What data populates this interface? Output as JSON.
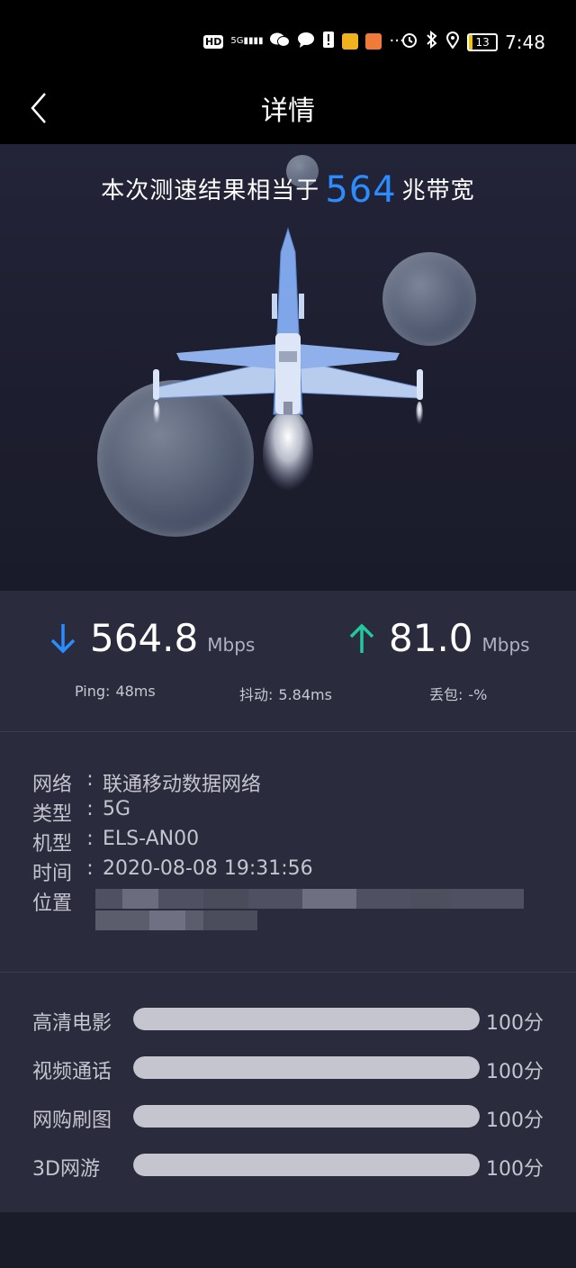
{
  "status_bar": {
    "time": "7:48",
    "battery": "13",
    "network": "5G",
    "hd_label": "HD"
  },
  "header": {
    "title": "详情"
  },
  "hero": {
    "prefix": "本次测速结果相当于",
    "bandwidth": "564",
    "suffix": "兆带宽"
  },
  "speed": {
    "download_value": "564.8",
    "download_unit": "Mbps",
    "upload_value": "81.0",
    "upload_unit": "Mbps",
    "ping_label": "Ping:",
    "ping_value": "48ms",
    "jitter_label": "抖动:",
    "jitter_value": "5.84ms",
    "loss_label": "丢包:",
    "loss_value": "-%"
  },
  "info": {
    "network_label": "网络",
    "network_value": "联通移动数据网络",
    "type_label": "类型",
    "type_value": "5G",
    "model_label": "机型",
    "model_value": "ELS-AN00",
    "time_label": "时间",
    "time_value": "2020-08-08 19:31:56",
    "location_label": "位置",
    "colon": ":"
  },
  "scores": [
    {
      "name": "高清电影",
      "score": "100分",
      "level": 1.0
    },
    {
      "name": "视频通话",
      "score": "100分",
      "level": 1.0
    },
    {
      "name": "网购刷图",
      "score": "100分",
      "level": 1.0
    },
    {
      "name": "3D网游",
      "score": "100分",
      "level": 1.0
    }
  ],
  "colors": {
    "accent_blue": "#2b8cff",
    "upload_green": "#22c9a0",
    "bar_fill": "#c4c5cf"
  }
}
